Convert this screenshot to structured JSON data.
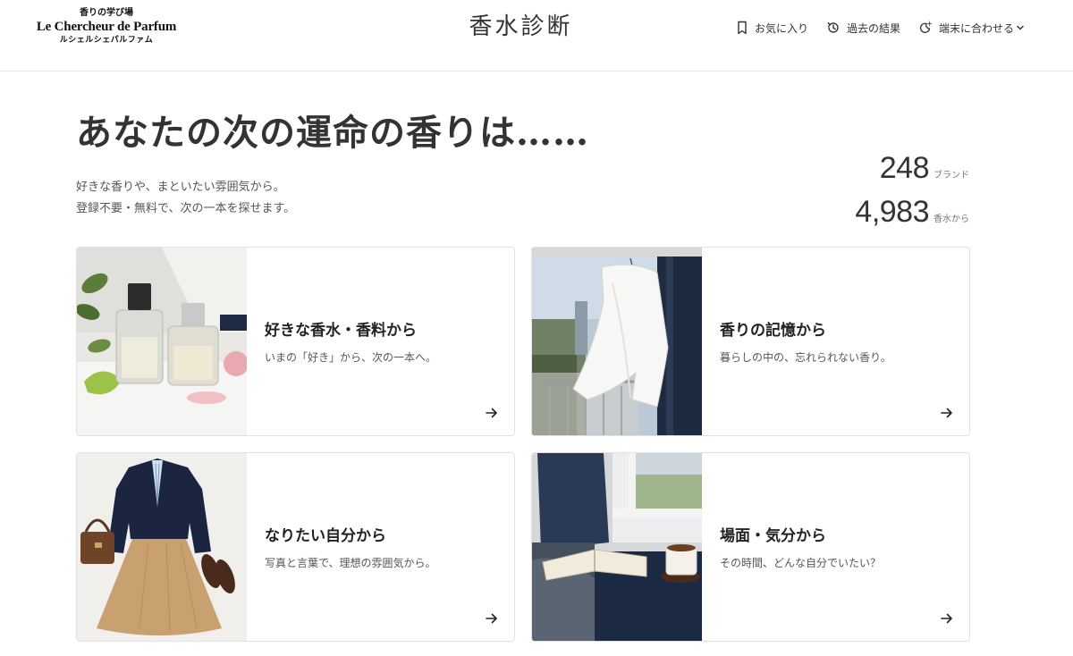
{
  "logo": {
    "top": "香りの学び場",
    "main": "Le Chercheur de Parfum",
    "sub": "ルシェルシェパルファム"
  },
  "app_title": "香水診断",
  "nav": {
    "favorites": "お気に入り",
    "history": "過去の結果",
    "theme": "端末に合わせる"
  },
  "hero": {
    "title": "あなたの次の運命の香りは……",
    "sub_line1": "好きな香りや、まといたい雰囲気から。",
    "sub_line2": "登録不要・無料で、次の一本を探せます。"
  },
  "stats": {
    "brands_count": "248",
    "brands_unit": "ブランド",
    "perfumes_count": "4,983",
    "perfumes_unit": "香水から"
  },
  "cards": [
    {
      "title": "好きな香水・香料から",
      "desc": "いまの「好き」から、次の一本へ。",
      "image": "perfume-bottles-image"
    },
    {
      "title": "香りの記憶から",
      "desc": "暮らしの中の、忘れられない香り。",
      "image": "white-shirt-window-image"
    },
    {
      "title": "なりたい自分から",
      "desc": "写真と言葉で、理想の雰囲気から。",
      "image": "outfit-flatlay-image"
    },
    {
      "title": "場面・気分から",
      "desc": "その時間、どんな自分でいたい？",
      "image": "window-seat-book-image"
    }
  ],
  "colors": {
    "text": "#222222",
    "border": "#e2e2e2",
    "muted": "#555555"
  }
}
